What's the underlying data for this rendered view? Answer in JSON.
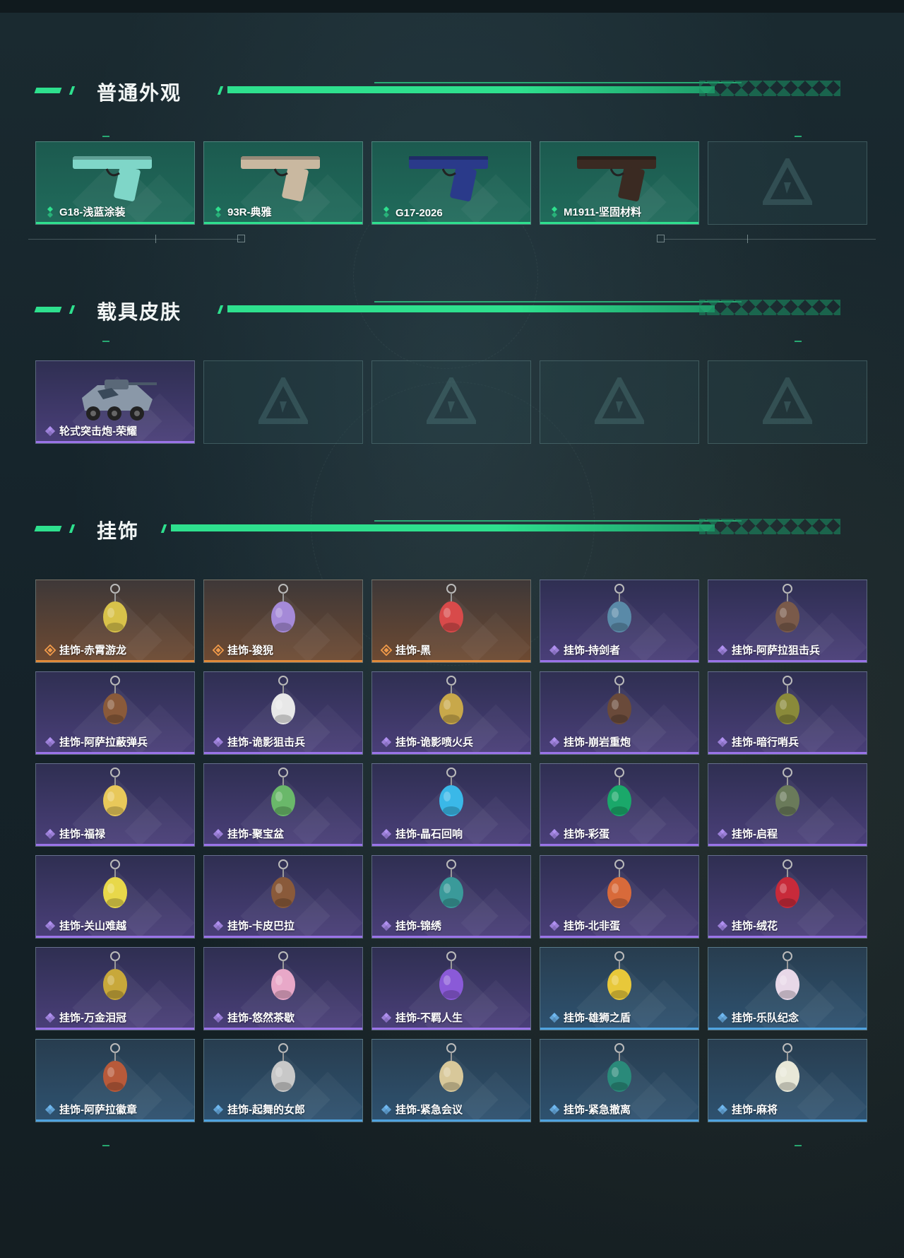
{
  "sections": {
    "skins": {
      "title": "普通外观",
      "items": [
        {
          "label": "G18-浅蓝涂装",
          "rarity": "green",
          "icon": "pistol-icon",
          "color": "#7fd6c8"
        },
        {
          "label": "93R-典雅",
          "rarity": "green",
          "icon": "pistol-icon",
          "color": "#c9b8a0"
        },
        {
          "label": "G17-2026",
          "rarity": "green",
          "icon": "pistol-icon",
          "color": "#2a3a8a"
        },
        {
          "label": "M1911-坚固材料",
          "rarity": "green",
          "icon": "pistol-icon",
          "color": "#3a2a22"
        },
        {
          "label": "",
          "rarity": "empty"
        }
      ]
    },
    "vehicles": {
      "title": "载具皮肤",
      "items": [
        {
          "label": "轮式突击炮-荣耀",
          "rarity": "purple",
          "icon": "armored-vehicle-icon"
        },
        {
          "label": "",
          "rarity": "empty"
        },
        {
          "label": "",
          "rarity": "empty"
        },
        {
          "label": "",
          "rarity": "empty"
        },
        {
          "label": "",
          "rarity": "empty"
        }
      ]
    },
    "charms": {
      "title": "挂饰",
      "items": [
        {
          "label": "挂饰-赤霄游龙",
          "rarity": "orange",
          "icon": "charm-icon",
          "color": "#d8c24a"
        },
        {
          "label": "挂饰-狻猊",
          "rarity": "orange",
          "icon": "charm-icon",
          "color": "#a58ad8"
        },
        {
          "label": "挂饰-黑",
          "rarity": "orange",
          "icon": "charm-icon",
          "color": "#d84a4a"
        },
        {
          "label": "挂饰-持剑者",
          "rarity": "purple",
          "icon": "charm-icon",
          "color": "#5a8aa8"
        },
        {
          "label": "挂饰-阿萨拉狙击兵",
          "rarity": "purple",
          "icon": "charm-icon",
          "color": "#7a5a4a"
        },
        {
          "label": "挂饰-阿萨拉蔽弹兵",
          "rarity": "purple",
          "icon": "charm-icon",
          "color": "#8a5a3a"
        },
        {
          "label": "挂饰-诡影狙击兵",
          "rarity": "purple",
          "icon": "charm-icon",
          "color": "#e8e8e8"
        },
        {
          "label": "挂饰-诡影喷火兵",
          "rarity": "purple",
          "icon": "charm-icon",
          "color": "#c8a84a"
        },
        {
          "label": "挂饰-崩岩重炮",
          "rarity": "purple",
          "icon": "charm-icon",
          "color": "#6a4a3a"
        },
        {
          "label": "挂饰-暗行哨兵",
          "rarity": "purple",
          "icon": "charm-icon",
          "color": "#8a8a3a"
        },
        {
          "label": "挂饰-福禄",
          "rarity": "purple",
          "icon": "charm-icon",
          "color": "#e8c85a"
        },
        {
          "label": "挂饰-聚宝盆",
          "rarity": "purple",
          "icon": "charm-icon",
          "color": "#6ab86a"
        },
        {
          "label": "挂饰-晶石回响",
          "rarity": "purple",
          "icon": "charm-icon",
          "color": "#3ab8e8"
        },
        {
          "label": "挂饰-彩蛋",
          "rarity": "purple",
          "icon": "charm-icon",
          "color": "#1aa86a"
        },
        {
          "label": "挂饰-启程",
          "rarity": "purple",
          "icon": "charm-icon",
          "color": "#6a7a5a"
        },
        {
          "label": "挂饰-关山难越",
          "rarity": "purple",
          "icon": "charm-icon",
          "color": "#e8d84a"
        },
        {
          "label": "挂饰-卡皮巴拉",
          "rarity": "purple",
          "icon": "charm-icon",
          "color": "#8a5a3a"
        },
        {
          "label": "挂饰-锦绣",
          "rarity": "purple",
          "icon": "charm-icon",
          "color": "#3a9a9a"
        },
        {
          "label": "挂饰-北非蛋",
          "rarity": "purple",
          "icon": "charm-icon",
          "color": "#d86a3a"
        },
        {
          "label": "挂饰-绒花",
          "rarity": "purple",
          "icon": "charm-icon",
          "color": "#c82a3a"
        },
        {
          "label": "挂饰-万金泪冠",
          "rarity": "purple",
          "icon": "charm-icon",
          "color": "#c8a83a"
        },
        {
          "label": "挂饰-悠然茶歇",
          "rarity": "purple",
          "icon": "charm-icon",
          "color": "#e8a8c8"
        },
        {
          "label": "挂饰-不羁人生",
          "rarity": "purple",
          "icon": "charm-icon",
          "color": "#8a5ad8"
        },
        {
          "label": "挂饰-雄狮之盾",
          "rarity": "blue",
          "icon": "charm-icon",
          "color": "#e8c83a"
        },
        {
          "label": "挂饰-乐队纪念",
          "rarity": "blue",
          "icon": "charm-icon",
          "color": "#e8d8e8"
        },
        {
          "label": "挂饰-阿萨拉徽章",
          "rarity": "blue",
          "icon": "charm-icon",
          "color": "#b85a3a"
        },
        {
          "label": "挂饰-起舞的女郎",
          "rarity": "blue",
          "icon": "charm-icon",
          "color": "#c8c8c8"
        },
        {
          "label": "挂饰-紧急会议",
          "rarity": "blue",
          "icon": "charm-icon",
          "color": "#d8c89a"
        },
        {
          "label": "挂饰-紧急撤离",
          "rarity": "blue",
          "icon": "charm-icon",
          "color": "#2a8a7a"
        },
        {
          "label": "挂饰-麻将",
          "rarity": "blue",
          "icon": "charm-icon",
          "color": "#e8e8d8"
        }
      ]
    }
  },
  "colors": {
    "accent": "#2ee08e",
    "green": "#2ee08e",
    "purple": "#9a73e8",
    "orange": "#e08a3a",
    "blue": "#4fa3e0"
  }
}
